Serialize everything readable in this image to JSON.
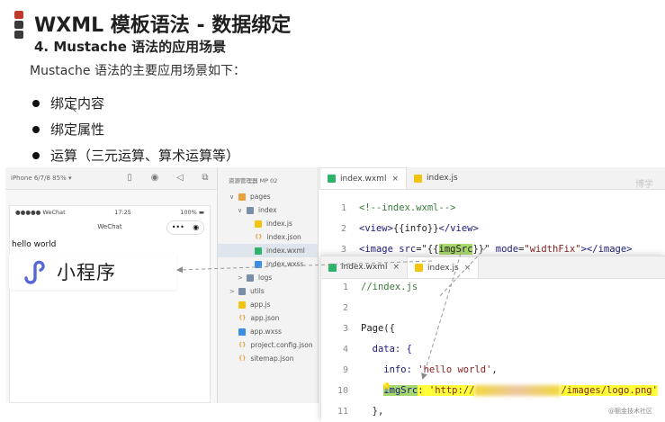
{
  "slide": {
    "title": "WXML 模板语法 - 数据绑定",
    "subtitle": "4. Mustache 语法的应用场景",
    "intro": "Mustache 语法的主要应用场景如下：",
    "bullets": [
      "绑定内容",
      "绑定属性",
      "运算（三元运算、算术运算等）"
    ],
    "accent_colors": [
      "#c0392b",
      "#3a3a3a",
      "#3a3a3a"
    ]
  },
  "simulator": {
    "device": "iPhone 6/7/8 85% ▾",
    "status_carrier": "●●●●● WeChat",
    "status_time": "17:25",
    "status_battery": "100% ▬",
    "nav_title": "WeChat",
    "capsule_more": "•••",
    "capsule_close": "◉",
    "page_text": "hello world",
    "logo_text": "小程序",
    "logo_color": "#5566d6"
  },
  "file_tree": {
    "header": "资源管理器  MP  02",
    "items": [
      {
        "label": "pages",
        "type": "folder",
        "indent": 1,
        "arrow": "∨"
      },
      {
        "label": "index",
        "type": "folder2",
        "indent": 2,
        "arrow": "∨"
      },
      {
        "label": "index.js",
        "type": "js",
        "indent": 3,
        "arrow": ""
      },
      {
        "label": "index.json",
        "type": "json",
        "indent": 3,
        "arrow": ""
      },
      {
        "label": "index.wxml",
        "type": "wxml",
        "indent": 3,
        "arrow": "",
        "selected": true
      },
      {
        "label": "index.wxss",
        "type": "wxss",
        "indent": 3,
        "arrow": ""
      },
      {
        "label": "logs",
        "type": "folder2",
        "indent": 2,
        "arrow": ">"
      },
      {
        "label": "utils",
        "type": "folder2",
        "indent": 1,
        "arrow": ">"
      },
      {
        "label": "app.js",
        "type": "js",
        "indent": 1,
        "arrow": ""
      },
      {
        "label": "app.json",
        "type": "json",
        "indent": 1,
        "arrow": ""
      },
      {
        "label": "app.wxss",
        "type": "wxss",
        "indent": 1,
        "arrow": ""
      },
      {
        "label": "project.config.json",
        "type": "json",
        "indent": 1,
        "arrow": ""
      },
      {
        "label": "sitemap.json",
        "type": "json",
        "indent": 1,
        "arrow": ""
      }
    ]
  },
  "editor_wxml": {
    "tabs": [
      {
        "label": "index.wxml",
        "active": true
      },
      {
        "label": "index.js",
        "active": false
      }
    ],
    "lines": [
      {
        "n": "1",
        "parts": [
          {
            "t": "<!--index.wxml-->",
            "c": "com"
          }
        ]
      },
      {
        "n": "2",
        "parts": [
          {
            "t": "<view>",
            "c": "tag"
          },
          {
            "t": "{{",
            "c": "txt"
          },
          {
            "t": "info",
            "c": "txt"
          },
          {
            "t": "}}",
            "c": "txt"
          },
          {
            "t": "</view>",
            "c": "tag"
          }
        ]
      },
      {
        "n": "3",
        "parts": [
          {
            "t": "<image ",
            "c": "tag"
          },
          {
            "t": "src",
            "c": "key"
          },
          {
            "t": "=\"{{",
            "c": "txt"
          },
          {
            "t": "imgSrc",
            "c": "txt",
            "hl": "green"
          },
          {
            "t": "}}\" ",
            "c": "txt"
          },
          {
            "t": "mode",
            "c": "key"
          },
          {
            "t": "=",
            "c": "txt"
          },
          {
            "t": "\"widthFix\"",
            "c": "str"
          },
          {
            "t": "></image>",
            "c": "tag"
          }
        ]
      }
    ]
  },
  "editor_js": {
    "tabs": [
      {
        "label": "index.wxml",
        "active": false
      },
      {
        "label": "index.js",
        "active": true
      }
    ],
    "lines": [
      {
        "n": "1",
        "parts": [
          {
            "t": "//index.js",
            "c": "com"
          }
        ]
      },
      {
        "n": "2",
        "parts": []
      },
      {
        "n": "3",
        "parts": [
          {
            "t": "Page({",
            "c": "txt"
          }
        ]
      },
      {
        "n": "4",
        "parts": [
          {
            "t": "  data: {",
            "c": "key"
          }
        ]
      },
      {
        "n": "9",
        "parts": [
          {
            "t": "    info: ",
            "c": "key"
          },
          {
            "t": "'hello world'",
            "c": "str"
          },
          {
            "t": ",",
            "c": "txt"
          }
        ]
      },
      {
        "n": "10",
        "parts": [
          {
            "t": "    ",
            "c": "txt"
          },
          {
            "t": "imgSrc",
            "c": "key",
            "hl": "green"
          },
          {
            "t": ": ",
            "c": "txt",
            "hl": "yellow"
          },
          {
            "t": "'http://",
            "c": "str",
            "hl": "yellow"
          },
          {
            "t": "",
            "c": "blur"
          },
          {
            "t": "/images/logo.png'",
            "c": "str",
            "hl": "yellow"
          }
        ]
      },
      {
        "n": "11",
        "parts": [
          {
            "t": "  },",
            "c": "txt"
          }
        ]
      }
    ]
  },
  "watermarks": {
    "top_right": "博学",
    "bottom_right": "@掘金技术社区"
  }
}
